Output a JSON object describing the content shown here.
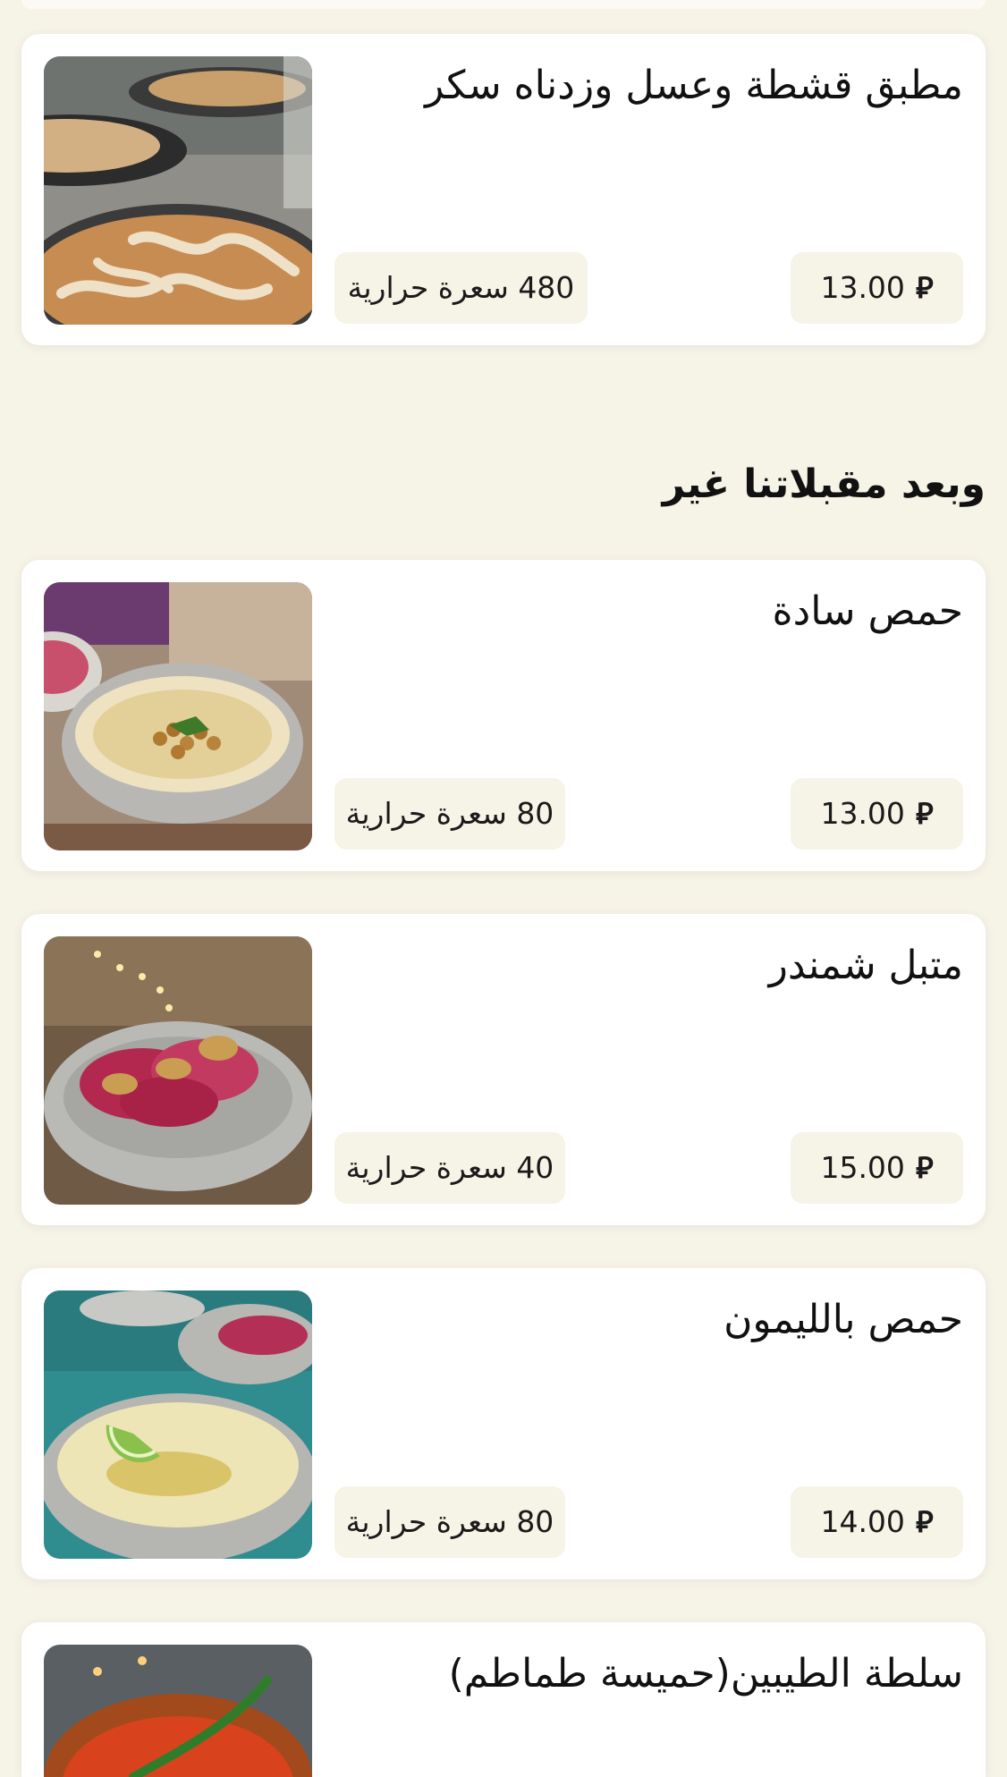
{
  "section": {
    "title": "وبعد مقبلاتنا غير"
  },
  "currency_symbol": "⃁",
  "items": [
    {
      "name": "مطبق قشطة وعسل وزدناه سكر",
      "price": "13.00",
      "calories": "480 سعرة حرارية",
      "image": "qishta-mutabbaq-photo"
    },
    {
      "name": "حمص سادة",
      "price": "13.00",
      "calories": "80 سعرة حرارية",
      "image": "plain-hummus-photo"
    },
    {
      "name": "متبل شمندر",
      "price": "15.00",
      "calories": "40 سعرة حرارية",
      "image": "beetroot-mutabbal-photo"
    },
    {
      "name": "حمص بالليمون",
      "price": "14.00",
      "calories": "80 سعرة حرارية",
      "image": "lemon-hummus-photo"
    },
    {
      "name": "سلطة الطيبين(حميسة طماطم)",
      "image": "tomato-salad-photo"
    }
  ]
}
